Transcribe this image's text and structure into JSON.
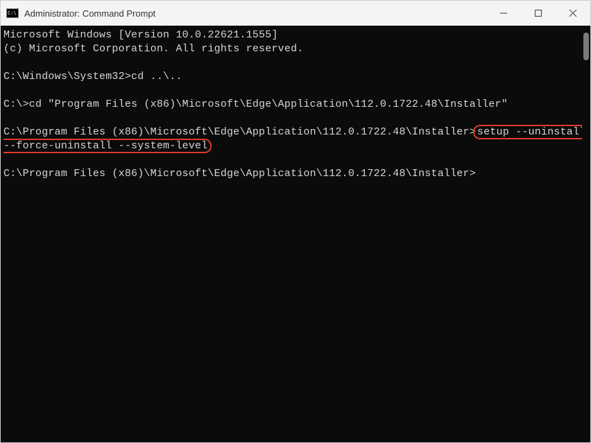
{
  "colors": {
    "terminal_bg": "#0b0b0b",
    "terminal_fg": "#d6d6d6",
    "highlight_border": "#e03a2a",
    "titlebar_bg": "#f4f4f4"
  },
  "titlebar": {
    "icon_name": "cmd-icon",
    "title": "Administrator: Command Prompt"
  },
  "terminal": {
    "lines": [
      {
        "kind": "text",
        "text": "Microsoft Windows [Version 10.0.22621.1555]"
      },
      {
        "kind": "text",
        "text": "(c) Microsoft Corporation. All rights reserved."
      },
      {
        "kind": "blank"
      },
      {
        "kind": "prompt",
        "prompt": "C:\\Windows\\System32>",
        "input": "cd ..\\.."
      },
      {
        "kind": "blank"
      },
      {
        "kind": "prompt",
        "prompt": "C:\\>",
        "input": "cd \"Program Files (x86)\\Microsoft\\Edge\\Application\\112.0.1722.48\\Installer\""
      },
      {
        "kind": "blank"
      },
      {
        "kind": "prompt-hl",
        "prompt": "C:\\Program Files (x86)\\Microsoft\\Edge\\Application\\112.0.1722.48\\Installer>",
        "hl1": "setup --uninstall ",
        "hl2": "--force-uninstall --system-level"
      },
      {
        "kind": "blank"
      },
      {
        "kind": "prompt",
        "prompt": "C:\\Program Files (x86)\\Microsoft\\Edge\\Application\\112.0.1722.48\\Installer>",
        "input": ""
      }
    ]
  }
}
